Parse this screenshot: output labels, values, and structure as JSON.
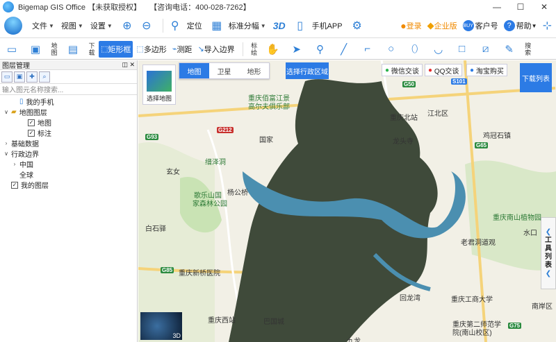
{
  "window": {
    "title": "Bigemap GIS Office 【未获取授权】",
    "phone": "【咨询电话：400-028-7262】",
    "minimize": "—",
    "maximize": "☐",
    "close": "✕"
  },
  "menu": {
    "file": "文件",
    "view": "视图",
    "settings": "设置",
    "locate": "定位",
    "standard_grid": "标准分幅",
    "three_d": "3D",
    "mobile_app": "手机APP"
  },
  "right_menu": {
    "login": "登录",
    "enterprise": "企业版",
    "account": "客户号",
    "help": "帮助"
  },
  "toolbar": {
    "map_label": "地图",
    "download_label": "下载",
    "rect": "矩形框",
    "polygon": "多边形",
    "measure": "测距",
    "import_border": "导入边界",
    "mark_label": "标绘",
    "search_label": "搜索"
  },
  "panel": {
    "title": "图层管理",
    "search_placeholder": "输入图元名称搜索...",
    "tree": [
      {
        "label": "我的手机",
        "level": 1,
        "kind": "phone"
      },
      {
        "label": "地图图层",
        "level": 0,
        "kind": "folder",
        "expanded": true
      },
      {
        "label": "地图",
        "level": 2,
        "kind": "check",
        "checked": true
      },
      {
        "label": "标注",
        "level": 2,
        "kind": "check",
        "checked": true
      },
      {
        "label": "基础数据",
        "level": 0,
        "kind": "expander",
        "expanded": false
      },
      {
        "label": "行政边界",
        "level": 0,
        "kind": "expander",
        "expanded": true
      },
      {
        "label": "中国",
        "level": 1,
        "kind": "expander",
        "expanded": false
      },
      {
        "label": "全球",
        "level": 1,
        "kind": "plain"
      },
      {
        "label": "我的图层",
        "level": 0,
        "kind": "check",
        "checked": true
      }
    ]
  },
  "map": {
    "tabs": {
      "map": "地图",
      "satellite": "卫星",
      "terrain": "地形"
    },
    "select_region": "选择行政区域",
    "wechat": "微信交谈",
    "qq": "QQ交谈",
    "taobao": "淘宝购买",
    "download_list": "下载列表",
    "select_map": "选择地图",
    "tool_list": [
      "工",
      "具",
      "列",
      "表"
    ],
    "minimap_label": "3D",
    "labels": [
      "重庆佰富江景",
      "高尔夫俱乐部",
      "重庆北站",
      "江北区",
      "龙头寺",
      "歌乐山国",
      "家森林公园",
      "杨公桥",
      "重庆南山植物园",
      "老君洞道观",
      "重庆新桥医院",
      "重庆西站",
      "巴国城",
      "回龙湾",
      "重庆工商大学",
      "重庆第二师范学",
      "院(南山校区)",
      "缙泽洞",
      "玄女",
      "国家",
      "鸡冠石镇",
      "白石驿",
      "南岸区",
      "九龙",
      "水口"
    ],
    "shields": [
      "G212",
      "G93",
      "G50",
      "G65",
      "G85",
      "G75",
      "S101"
    ]
  }
}
